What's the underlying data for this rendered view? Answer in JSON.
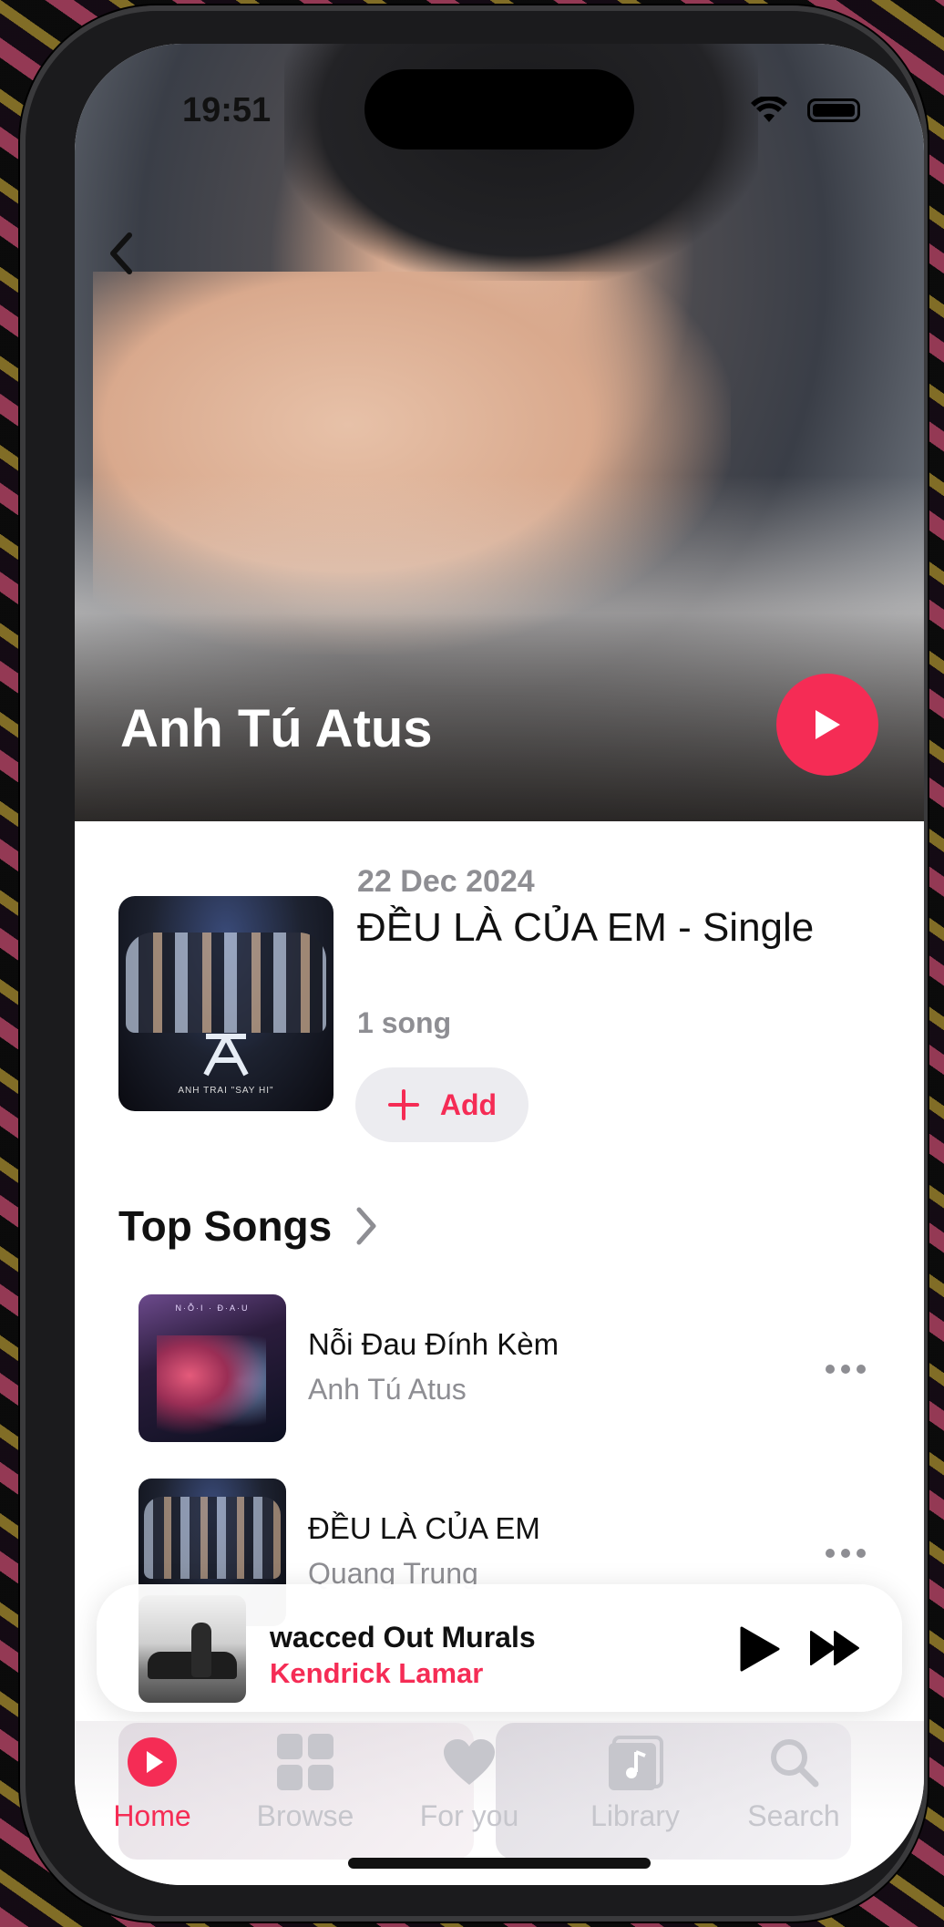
{
  "status_bar": {
    "time": "19:51"
  },
  "artist": {
    "name": "Anh Tú Atus"
  },
  "latest_release": {
    "date": "22 Dec 2024",
    "title": "ĐỀU LÀ CỦA EM - Single",
    "song_count": "1 song",
    "add_label": "Add",
    "art_caption": "ANH TRAI \"SAY HI\""
  },
  "top_songs": {
    "title": "Top Songs",
    "items": [
      {
        "title": "Nỗi Đau Đính Kèm",
        "artist": "Anh Tú Atus"
      },
      {
        "title": "ĐỀU LÀ CỦA EM",
        "artist": "Quang Trung"
      }
    ]
  },
  "now_playing": {
    "title": "wacced Out Murals",
    "artist": "Kendrick Lamar"
  },
  "tabs": [
    {
      "label": "Home",
      "icon": "home-icon",
      "active": true
    },
    {
      "label": "Browse",
      "icon": "grid-icon"
    },
    {
      "label": "For you",
      "icon": "heart-icon"
    },
    {
      "label": "Library",
      "icon": "music-note-icon"
    },
    {
      "label": "Search",
      "icon": "search-icon"
    }
  ],
  "colors": {
    "accent": "#f52c55",
    "secondary_text": "#8e8e93"
  }
}
